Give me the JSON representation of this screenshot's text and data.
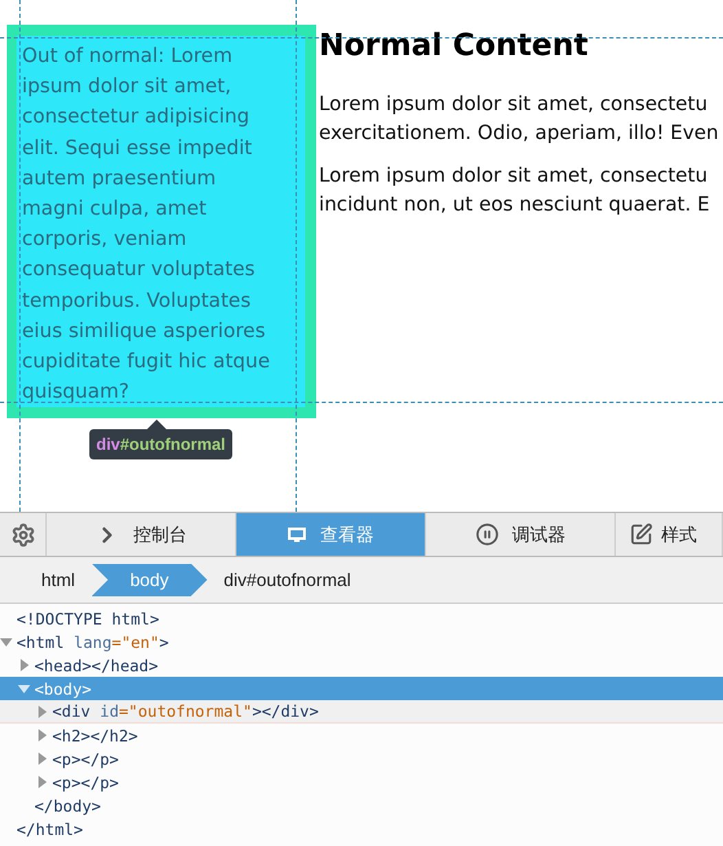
{
  "page": {
    "box_text": [
      "Out of normal: Lorem",
      "ipsum dolor sit amet,",
      "consectetur adipisicing",
      "elit. Sequi esse impedit",
      "autem praesentium",
      "magni culpa, amet",
      "corporis, veniam",
      "consequatur voluptates",
      "temporibus. Voluptates",
      "eius similique asperiores",
      "cupiditate fugit hic atque",
      "quisquam?"
    ],
    "heading": "Normal Content",
    "paragraphs": [
      [
        "Lorem ipsum dolor sit amet, consectetu",
        "exercitationem. Odio, aperiam, illo! Even"
      ],
      [
        "Lorem ipsum dolor sit amet, consectetu",
        "incidunt non, ut eos nesciunt quaerat. E"
      ]
    ],
    "tooltip": {
      "tag": "div",
      "id": "#outofnormal"
    }
  },
  "toolbar": {
    "tabs": [
      {
        "label": "控制台",
        "kind": "console",
        "selected": false
      },
      {
        "label": "查看器",
        "kind": "inspector",
        "selected": true
      },
      {
        "label": "调试器",
        "kind": "debugger",
        "selected": false
      },
      {
        "label": "样式",
        "kind": "style",
        "selected": false
      }
    ]
  },
  "breadcrumbs": [
    {
      "label": "html",
      "selected": false
    },
    {
      "label": "body",
      "selected": true
    },
    {
      "label": "div#outofnormal",
      "selected": false
    }
  ],
  "tree": [
    {
      "tag_open": "<!DOCTYPE html",
      "tag_close": ">",
      "selected": false,
      "hovered": false
    },
    {
      "tag_open": "<html",
      "attributes": [
        {
          "name": "lang",
          "value": "=\"en\""
        }
      ],
      "tag_close": ">",
      "expanded": true,
      "selected": false,
      "hovered": false,
      "closing": "</html>",
      "children": [
        {
          "tag_open": "<head",
          "tag_close": "></head>",
          "expanded": false,
          "selected": false,
          "hovered": false
        },
        {
          "tag_open": "<body",
          "tag_close": ">",
          "expanded": true,
          "selected": true,
          "hovered": false,
          "closing": "</body>",
          "children": [
            {
              "tag_open": "<div",
              "attributes": [
                {
                  "name": "id",
                  "value": "=\"outofnormal\""
                }
              ],
              "tag_close": "></div>",
              "expanded": false,
              "selected": false,
              "hovered": true
            },
            {
              "tag_open": "<h2",
              "tag_close": "></h2>",
              "expanded": false,
              "selected": false,
              "hovered": false
            },
            {
              "tag_open": "<p",
              "tag_close": "></p>",
              "expanded": false,
              "selected": false,
              "hovered": false
            },
            {
              "tag_open": "<p",
              "tag_close": "></p>",
              "expanded": false,
              "selected": false,
              "hovered": false
            }
          ]
        }
      ]
    }
  ]
}
